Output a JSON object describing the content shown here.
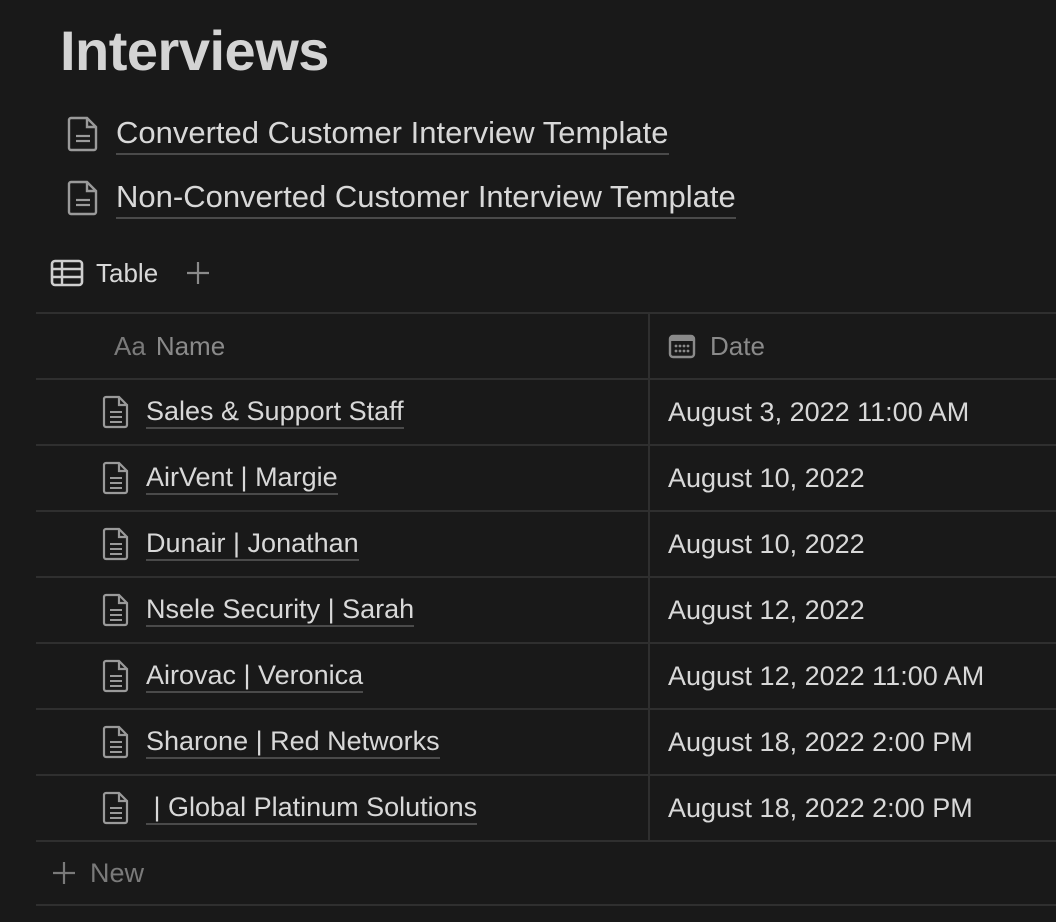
{
  "page": {
    "title": "Interviews"
  },
  "templates": [
    {
      "label": "Converted Customer Interview Template",
      "icon": "document-icon"
    },
    {
      "label": "Non-Converted Customer Interview Template",
      "icon": "document-icon"
    }
  ],
  "view": {
    "label": "Table",
    "icon": "table-icon",
    "add_icon": "plus-icon"
  },
  "table": {
    "columns": [
      {
        "prefix": "Aa",
        "label": "Name"
      },
      {
        "icon": "calendar-icon",
        "label": "Date"
      }
    ],
    "rows": [
      {
        "name": "Sales & Support Staff",
        "date": "August 3, 2022 11:00 AM"
      },
      {
        "name": "AirVent | Margie",
        "date": "August 10, 2022"
      },
      {
        "name": "Dunair | Jonathan",
        "date": "August 10, 2022"
      },
      {
        "name": "Nsele Security | Sarah",
        "date": "August 12, 2022"
      },
      {
        "name": "Airovac | Veronica",
        "date": "August 12, 2022 11:00 AM"
      },
      {
        "name": "Sharone | Red Networks",
        "date": "August 18, 2022 2:00 PM"
      },
      {
        "name": " | Global Platinum Solutions",
        "date": "August 18, 2022 2:00 PM"
      }
    ],
    "new_label": "New"
  }
}
